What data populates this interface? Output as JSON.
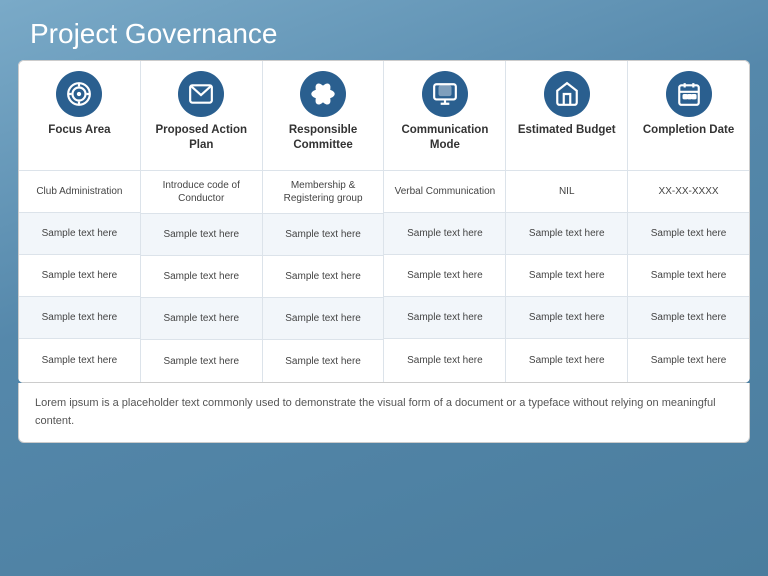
{
  "title": "Project Governance",
  "columns": [
    {
      "id": "focus-area",
      "icon": "target",
      "header": "Focus Area",
      "rows": [
        "Club Administration",
        "Sample text here",
        "Sample text here",
        "Sample text here",
        "Sample text here"
      ]
    },
    {
      "id": "proposed-action",
      "icon": "email",
      "header": "Proposed Action Plan",
      "rows": [
        "Introduce code of Conductor",
        "Sample text here",
        "Sample text here",
        "Sample text here",
        "Sample text here"
      ]
    },
    {
      "id": "responsible-committee",
      "icon": "atom",
      "header": "Responsible Committee",
      "rows": [
        "Membership & Registering group",
        "Sample text here",
        "Sample text here",
        "Sample text here",
        "Sample text here"
      ]
    },
    {
      "id": "communication-mode",
      "icon": "monitor",
      "header": "Communication Mode",
      "rows": [
        "Verbal Communication",
        "Sample text here",
        "Sample text here",
        "Sample text here",
        "Sample text here"
      ]
    },
    {
      "id": "estimated-budget",
      "icon": "home",
      "header": "Estimated Budget",
      "rows": [
        "NIL",
        "Sample text here",
        "Sample text here",
        "Sample text here",
        "Sample text here"
      ]
    },
    {
      "id": "completion-date",
      "icon": "calendar",
      "header": "Completion Date",
      "rows": [
        "XX-XX-XXXX",
        "Sample text here",
        "Sample text here",
        "Sample text here",
        "Sample text here"
      ]
    }
  ],
  "footer": "Lorem ipsum is a placeholder text commonly used to demonstrate the visual form of a document or a typeface without relying on meaningful content."
}
